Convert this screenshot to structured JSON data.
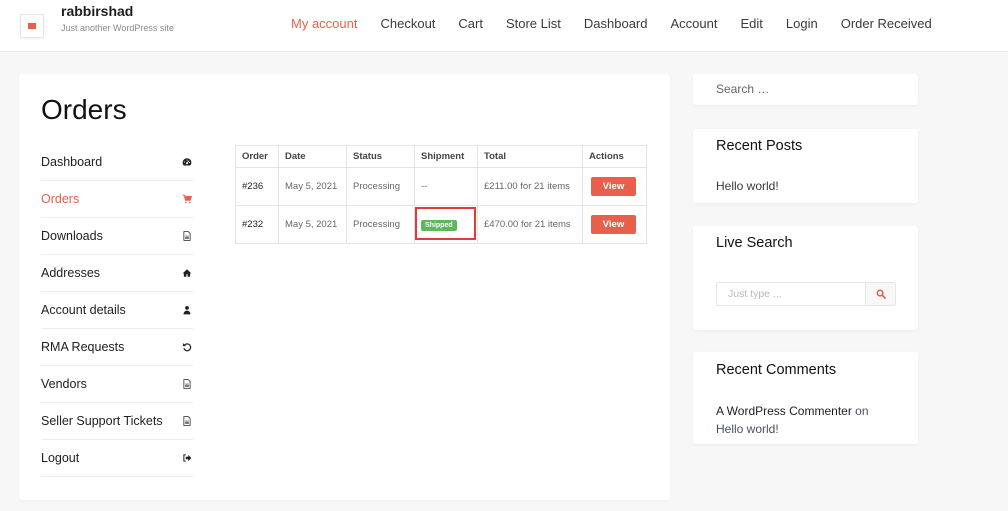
{
  "header": {
    "site_title": "rabbirshad",
    "site_description": "Just another WordPress site",
    "menu_icon": "hamburger-icon",
    "nav": [
      {
        "label": "My account",
        "active": true
      },
      {
        "label": "Checkout",
        "active": false
      },
      {
        "label": "Cart",
        "active": false
      },
      {
        "label": "Store List",
        "active": false
      },
      {
        "label": "Dashboard",
        "active": false
      },
      {
        "label": "Account",
        "active": false
      },
      {
        "label": "Edit",
        "active": false
      },
      {
        "label": "Login",
        "active": false
      },
      {
        "label": "Order Received",
        "active": false
      }
    ]
  },
  "page": {
    "title": "Orders"
  },
  "account_nav": [
    {
      "label": "Dashboard",
      "icon": "dashboard-gauge-icon",
      "active": false
    },
    {
      "label": "Orders",
      "icon": "shopping-cart-icon",
      "active": true
    },
    {
      "label": "Downloads",
      "icon": "file-icon",
      "active": false
    },
    {
      "label": "Addresses",
      "icon": "home-icon",
      "active": false
    },
    {
      "label": "Account details",
      "icon": "user-icon",
      "active": false
    },
    {
      "label": "RMA Requests",
      "icon": "undo-icon",
      "active": false
    },
    {
      "label": "Vendors",
      "icon": "file-icon",
      "active": false
    },
    {
      "label": "Seller Support Tickets",
      "icon": "file-icon",
      "active": false
    },
    {
      "label": "Logout",
      "icon": "sign-out-icon",
      "active": false
    }
  ],
  "orders_table": {
    "headers": [
      "Order",
      "Date",
      "Status",
      "Shipment",
      "Total",
      "Actions"
    ],
    "rows": [
      {
        "order": "#236",
        "date": "May 5, 2021",
        "status": "Processing",
        "shipment": "--",
        "total": "£211.00 for 21 items",
        "action": "View"
      },
      {
        "order": "#232",
        "date": "May 5, 2021",
        "status": "Processing",
        "shipment_badge": "Shipped",
        "total": "£470.00 for 21 items",
        "action": "View"
      }
    ]
  },
  "sidebar": {
    "search_placeholder": "Search …",
    "recent_posts": {
      "title": "Recent Posts",
      "items": [
        "Hello world!"
      ]
    },
    "live_search": {
      "title": "Live Search",
      "placeholder": "Just type ..."
    },
    "recent_comments": {
      "title": "Recent Comments",
      "author": "A WordPress Commenter",
      "on": "on",
      "post": "Hello world!"
    }
  },
  "colors": {
    "accent": "#e8604c",
    "badge_shipped": "#5cb85c",
    "highlight_box": "#e03a3a"
  }
}
